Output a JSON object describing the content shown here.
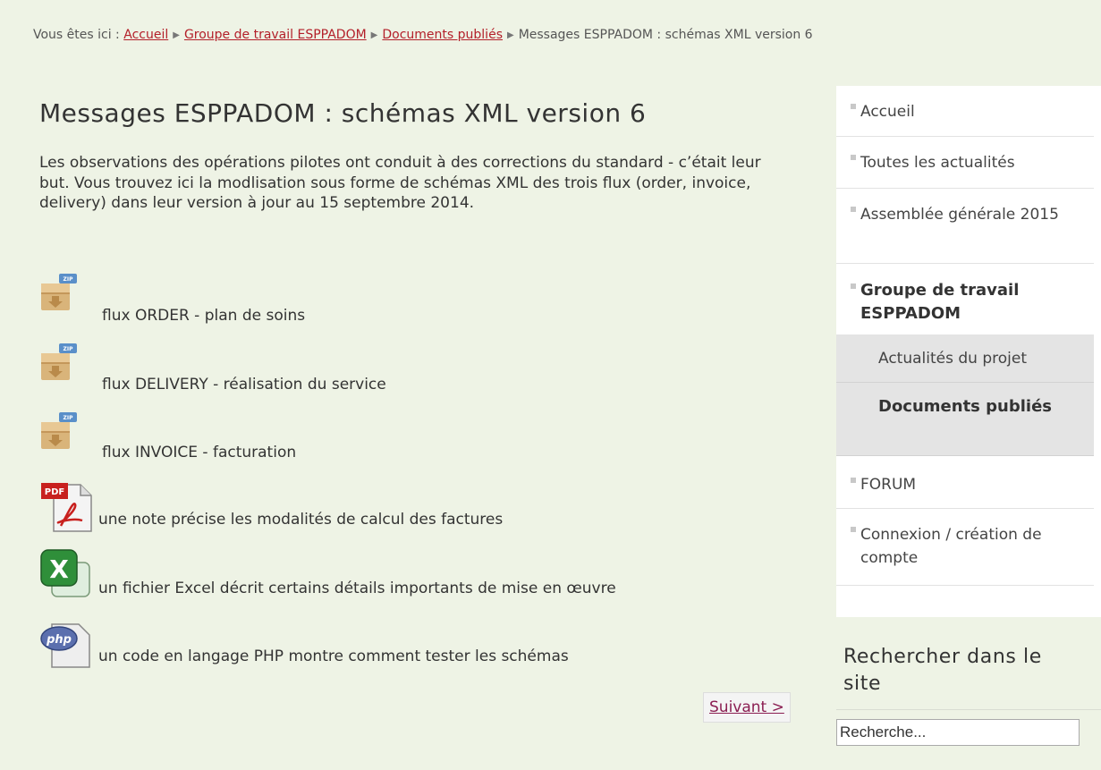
{
  "breadcrumb": {
    "prefix": "Vous êtes ici : ",
    "links": [
      "Accueil",
      "Groupe de travail ESPPADOM",
      "Documents publiés"
    ],
    "current": "Messages ESPPADOM : schémas XML version 6"
  },
  "article": {
    "title": "Messages ESPPADOM : schémas XML version 6",
    "intro": "Les observations des opérations pilotes ont conduit à des corrections du standard - c’était leur but. Vous trouvez ici la modlisation sous forme de schémas XML des trois flux (order, invoice, delivery) dans leur version à jour au 15 septembre 2014.",
    "files": [
      {
        "icon": "zip-archive-icon",
        "label": "flux ORDER - plan de soins"
      },
      {
        "icon": "zip-archive-icon",
        "label": "flux DELIVERY - réalisation du service"
      },
      {
        "icon": "zip-archive-icon",
        "label": "flux INVOICE - facturation"
      },
      {
        "icon": "pdf-file-icon",
        "label": "une note précise les modalités de calcul des factures"
      },
      {
        "icon": "excel-file-icon",
        "label": "un fichier Excel décrit certains détails importants de mise en œuvre"
      },
      {
        "icon": "php-file-icon",
        "label": "un code en langage PHP montre comment tester les schémas"
      }
    ],
    "next_label": "Suivant >"
  },
  "sidebar": {
    "items": [
      {
        "label": "Accueil"
      },
      {
        "label": "Toutes les actualités"
      },
      {
        "label": "Assemblée générale 2015"
      },
      {
        "label": "Groupe de travail ESPPADOM",
        "active": true
      },
      {
        "label": "FORUM"
      },
      {
        "label": "Connexion / création de compte"
      }
    ],
    "subitems": [
      {
        "label": "Actualités du projet"
      },
      {
        "label": "Documents publiés",
        "active": true
      }
    ]
  },
  "search": {
    "title": "Rechercher dans le site",
    "value": "Recherche..."
  },
  "colors": {
    "page_background": "#eef3e5",
    "link": "#b3202a",
    "next_button_text": "#8b1e52",
    "submenu_background": "#e4e4e4"
  }
}
